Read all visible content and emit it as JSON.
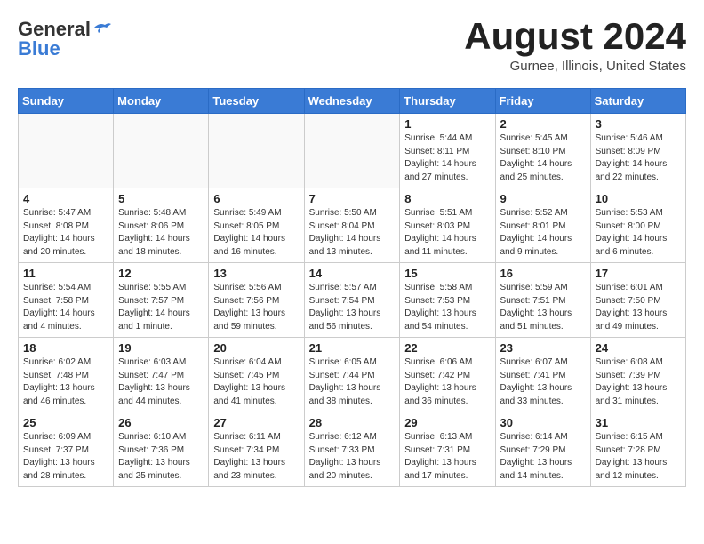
{
  "header": {
    "logo_line1": "General",
    "logo_line2": "Blue",
    "month_title": "August 2024",
    "location": "Gurnee, Illinois, United States"
  },
  "days_of_week": [
    "Sunday",
    "Monday",
    "Tuesday",
    "Wednesday",
    "Thursday",
    "Friday",
    "Saturday"
  ],
  "weeks": [
    [
      {
        "day": "",
        "info": ""
      },
      {
        "day": "",
        "info": ""
      },
      {
        "day": "",
        "info": ""
      },
      {
        "day": "",
        "info": ""
      },
      {
        "day": "1",
        "info": "Sunrise: 5:44 AM\nSunset: 8:11 PM\nDaylight: 14 hours and 27 minutes."
      },
      {
        "day": "2",
        "info": "Sunrise: 5:45 AM\nSunset: 8:10 PM\nDaylight: 14 hours and 25 minutes."
      },
      {
        "day": "3",
        "info": "Sunrise: 5:46 AM\nSunset: 8:09 PM\nDaylight: 14 hours and 22 minutes."
      }
    ],
    [
      {
        "day": "4",
        "info": "Sunrise: 5:47 AM\nSunset: 8:08 PM\nDaylight: 14 hours and 20 minutes."
      },
      {
        "day": "5",
        "info": "Sunrise: 5:48 AM\nSunset: 8:06 PM\nDaylight: 14 hours and 18 minutes."
      },
      {
        "day": "6",
        "info": "Sunrise: 5:49 AM\nSunset: 8:05 PM\nDaylight: 14 hours and 16 minutes."
      },
      {
        "day": "7",
        "info": "Sunrise: 5:50 AM\nSunset: 8:04 PM\nDaylight: 14 hours and 13 minutes."
      },
      {
        "day": "8",
        "info": "Sunrise: 5:51 AM\nSunset: 8:03 PM\nDaylight: 14 hours and 11 minutes."
      },
      {
        "day": "9",
        "info": "Sunrise: 5:52 AM\nSunset: 8:01 PM\nDaylight: 14 hours and 9 minutes."
      },
      {
        "day": "10",
        "info": "Sunrise: 5:53 AM\nSunset: 8:00 PM\nDaylight: 14 hours and 6 minutes."
      }
    ],
    [
      {
        "day": "11",
        "info": "Sunrise: 5:54 AM\nSunset: 7:58 PM\nDaylight: 14 hours and 4 minutes."
      },
      {
        "day": "12",
        "info": "Sunrise: 5:55 AM\nSunset: 7:57 PM\nDaylight: 14 hours and 1 minute."
      },
      {
        "day": "13",
        "info": "Sunrise: 5:56 AM\nSunset: 7:56 PM\nDaylight: 13 hours and 59 minutes."
      },
      {
        "day": "14",
        "info": "Sunrise: 5:57 AM\nSunset: 7:54 PM\nDaylight: 13 hours and 56 minutes."
      },
      {
        "day": "15",
        "info": "Sunrise: 5:58 AM\nSunset: 7:53 PM\nDaylight: 13 hours and 54 minutes."
      },
      {
        "day": "16",
        "info": "Sunrise: 5:59 AM\nSunset: 7:51 PM\nDaylight: 13 hours and 51 minutes."
      },
      {
        "day": "17",
        "info": "Sunrise: 6:01 AM\nSunset: 7:50 PM\nDaylight: 13 hours and 49 minutes."
      }
    ],
    [
      {
        "day": "18",
        "info": "Sunrise: 6:02 AM\nSunset: 7:48 PM\nDaylight: 13 hours and 46 minutes."
      },
      {
        "day": "19",
        "info": "Sunrise: 6:03 AM\nSunset: 7:47 PM\nDaylight: 13 hours and 44 minutes."
      },
      {
        "day": "20",
        "info": "Sunrise: 6:04 AM\nSunset: 7:45 PM\nDaylight: 13 hours and 41 minutes."
      },
      {
        "day": "21",
        "info": "Sunrise: 6:05 AM\nSunset: 7:44 PM\nDaylight: 13 hours and 38 minutes."
      },
      {
        "day": "22",
        "info": "Sunrise: 6:06 AM\nSunset: 7:42 PM\nDaylight: 13 hours and 36 minutes."
      },
      {
        "day": "23",
        "info": "Sunrise: 6:07 AM\nSunset: 7:41 PM\nDaylight: 13 hours and 33 minutes."
      },
      {
        "day": "24",
        "info": "Sunrise: 6:08 AM\nSunset: 7:39 PM\nDaylight: 13 hours and 31 minutes."
      }
    ],
    [
      {
        "day": "25",
        "info": "Sunrise: 6:09 AM\nSunset: 7:37 PM\nDaylight: 13 hours and 28 minutes."
      },
      {
        "day": "26",
        "info": "Sunrise: 6:10 AM\nSunset: 7:36 PM\nDaylight: 13 hours and 25 minutes."
      },
      {
        "day": "27",
        "info": "Sunrise: 6:11 AM\nSunset: 7:34 PM\nDaylight: 13 hours and 23 minutes."
      },
      {
        "day": "28",
        "info": "Sunrise: 6:12 AM\nSunset: 7:33 PM\nDaylight: 13 hours and 20 minutes."
      },
      {
        "day": "29",
        "info": "Sunrise: 6:13 AM\nSunset: 7:31 PM\nDaylight: 13 hours and 17 minutes."
      },
      {
        "day": "30",
        "info": "Sunrise: 6:14 AM\nSunset: 7:29 PM\nDaylight: 13 hours and 14 minutes."
      },
      {
        "day": "31",
        "info": "Sunrise: 6:15 AM\nSunset: 7:28 PM\nDaylight: 13 hours and 12 minutes."
      }
    ]
  ]
}
